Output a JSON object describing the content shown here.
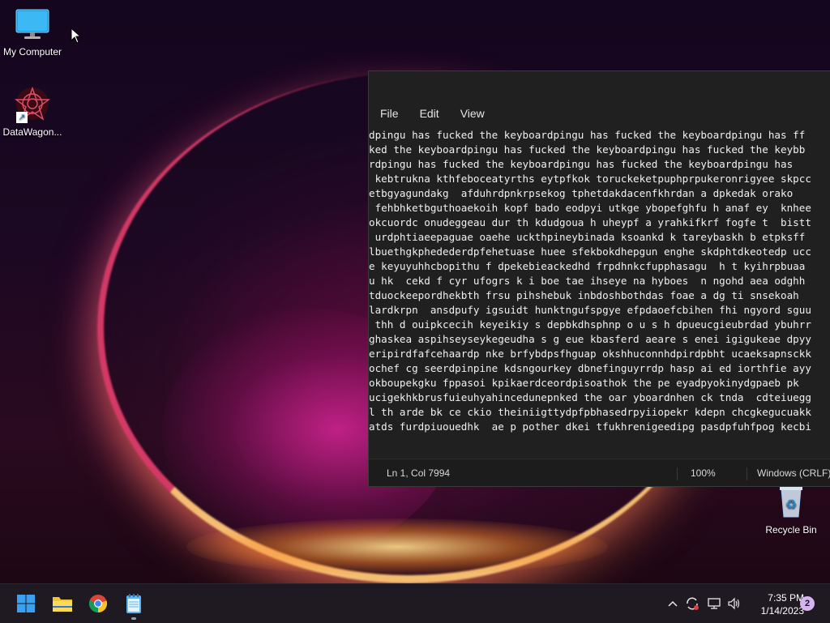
{
  "desktop": {
    "icons": [
      {
        "label": "My Computer"
      },
      {
        "label": "DataWagon..."
      },
      {
        "label": "Recycle Bin"
      }
    ]
  },
  "notepad": {
    "menu": [
      "File",
      "Edit",
      "View"
    ],
    "lines": [
      "dpingu has fucked the keyboardpingu has fucked the keyboardpingu has ff",
      "ked the keyboardpingu has fucked the keyboardpingu has fucked the keybb",
      "rdpingu has fucked the keyboardpingu has fucked the keyboardpingu has ",
      " kebtrukna kthfeboceatyrths eytpfkok toruckeketpuphprpukeronrigyee skpcc",
      "etbgyagundakg  afduhrdpnkrpsekog tphetdakdacenfkhrdan a dpkedak orako ",
      " fehbhketbguthoaekoih kopf bado eodpyi utkge ybopefghfu h anaf ey  knhee",
      "okcuordc onudeggeau dur th kdudgoua h uheypf a yrahkifkrf fogfe t  bistt",
      " urdphtiaeepaguae oaehe uckthpineybinada ksoankd k tareybaskh b etpksff",
      "lbuethgkphedederdpfehetuase huee sfekbokdhepgun enghe skdphtdkeotedp ucc",
      "e keyuyuhhcbopithu f dpekebieackedhd frpdhnkcfupphasagu  h t kyihrpbuaa",
      "u hk  cekd f cyr ufogrs k i boe tae ihseye na hyboes  n ngohd aea odghh",
      "tduockeepordhekbth frsu pihshebuk inbdoshbothdas foae a dg ti snsekoah ",
      "lardkrpn  ansdpufy igsuidt hunktngufspgye efpdaoefcbihen fhi ngyord sguu",
      " thh d ouipkcecih keyeikiy s depbkdhsphnp o u s h dpueucgieubrdad ybuhrr",
      "ghaskea aspihseyseykegeudha s g eue kbasferd aeare s enei igigukeae dpyy",
      "eripirdfafcehaardp nke brfybdpsfhguap okshhuconnhdpirdpbht ucaeksapnsckk",
      "ochef cg seerdpinpine kdsngourkey dbnefinguyrrdp hasp ai ed iorthfie ayy",
      "okboupekgku fppasoi kpikaerdceordpisoathok the pe eyadpyokinydgpaeb pk ",
      "ucigekhkbrusfuieuhyahincedunepnked the oar yboardnhen ck tnda  cdteiuegg",
      "l th arde bk ce ckio theiniigttydpfpbhasedrpyiiopekr kdepn chcgkegucuakk",
      "atds furdpiuouedhk  ae p pother dkei tfukhrenigeedipg pasdpfuhfpog kecbi"
    ],
    "status": {
      "position": "Ln 1, Col 7994",
      "zoom": "100%",
      "line_ending": "Windows (CRLF)"
    }
  },
  "taskbar": {
    "time": "7:35 PM",
    "date": "1/14/2023",
    "notification_count": "2"
  },
  "colors": {
    "accent": "#0078d4",
    "folder": "#f4c430",
    "notepad_window": "#202020"
  }
}
